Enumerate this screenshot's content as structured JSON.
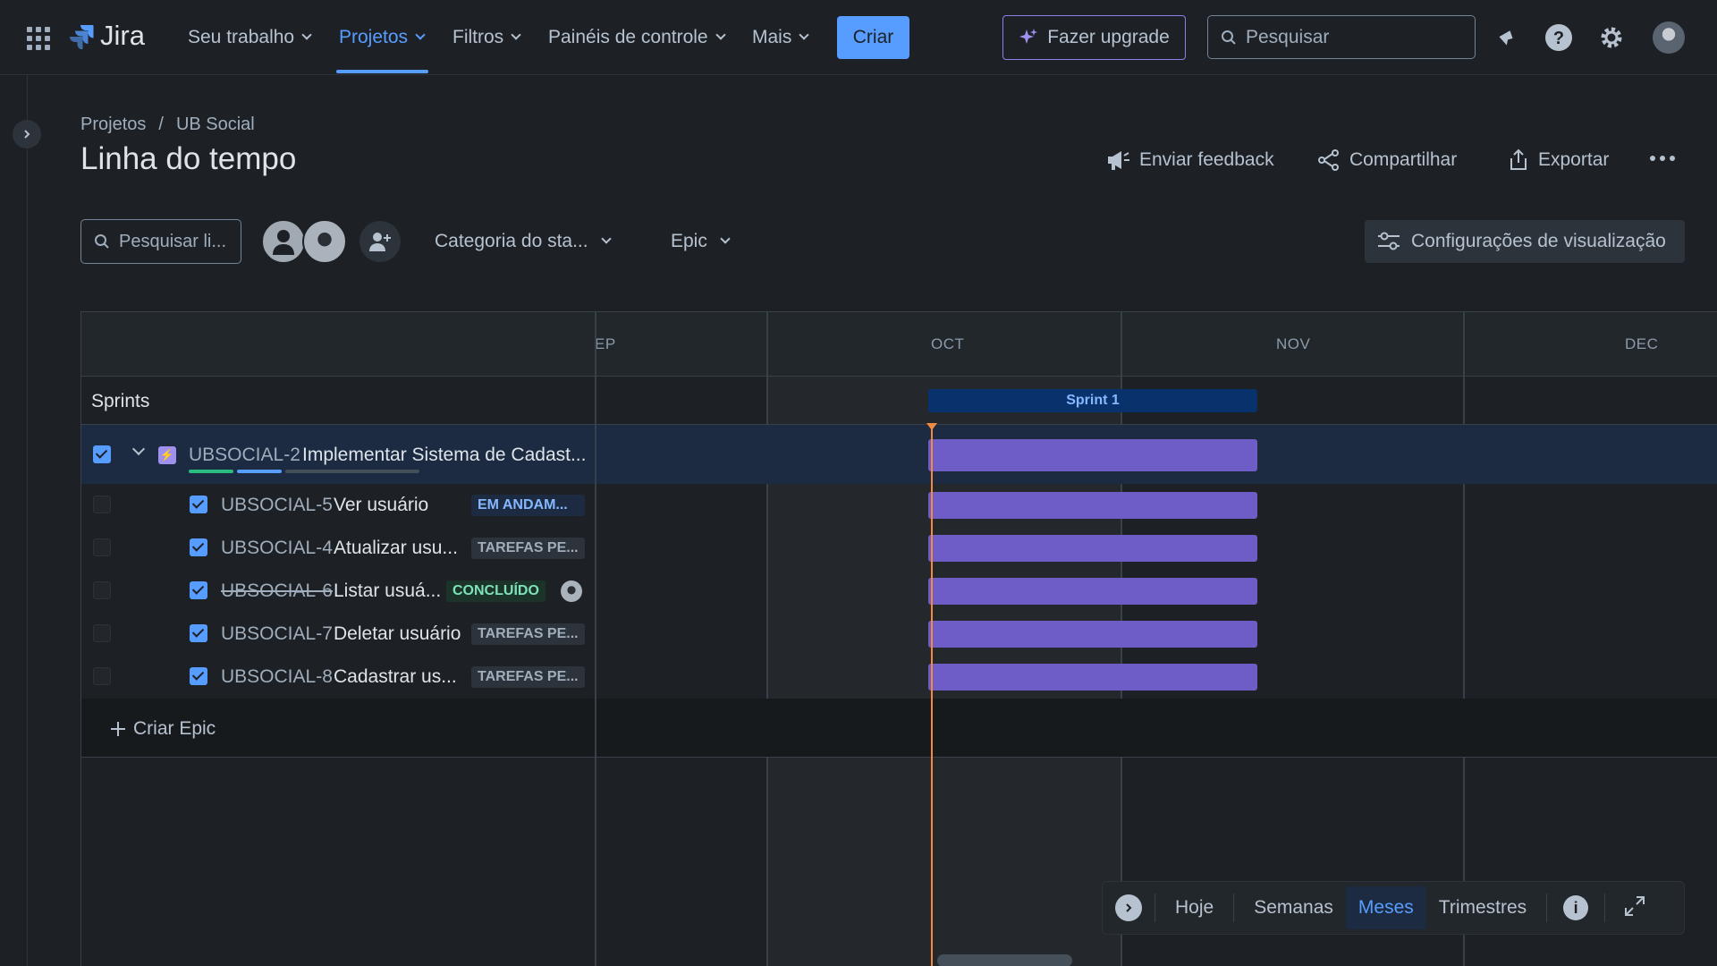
{
  "nav": {
    "product": "Jira",
    "items": [
      {
        "label": "Seu trabalho"
      },
      {
        "label": "Projetos"
      },
      {
        "label": "Filtros"
      },
      {
        "label": "Painéis de controle"
      },
      {
        "label": "Mais"
      }
    ],
    "create_label": "Criar",
    "upgrade_label": "Fazer upgrade",
    "search_placeholder": "Pesquisar"
  },
  "breadcrumb": {
    "root": "Projetos",
    "separator": "/",
    "project": "UB Social"
  },
  "page_title": "Linha do tempo",
  "actions": {
    "feedback": "Enviar feedback",
    "share": "Compartilhar",
    "export": "Exportar"
  },
  "filters": {
    "search_placeholder": "Pesquisar li...",
    "status_category": "Categoria do sta...",
    "epic": "Epic",
    "view_settings": "Configurações de visualização"
  },
  "timeline": {
    "months": [
      "EP",
      "OCT",
      "NOV",
      "DEC"
    ],
    "sprints_label": "Sprints",
    "sprint_name": "Sprint 1",
    "epic": {
      "key": "UBSOCIAL-2",
      "summary": "Implementar Sistema de Cadast..."
    },
    "issues": [
      {
        "key": "UBSOCIAL-5",
        "summary": "Ver usuário",
        "status": "EM ANDAM...",
        "status_type": "progress"
      },
      {
        "key": "UBSOCIAL-4",
        "summary": "Atualizar usu...",
        "status": "TAREFAS PE...",
        "status_type": "todo"
      },
      {
        "key": "UBSOCIAL-6",
        "summary": "Listar usuá...",
        "status": "CONCLUÍDO",
        "status_type": "done"
      },
      {
        "key": "UBSOCIAL-7",
        "summary": "Deletar usuário",
        "status": "TAREFAS PE...",
        "status_type": "todo"
      },
      {
        "key": "UBSOCIAL-8",
        "summary": "Cadastrar us...",
        "status": "TAREFAS PE...",
        "status_type": "todo"
      }
    ],
    "create_epic": "Criar Epic"
  },
  "zoom": {
    "today": "Hoje",
    "weeks": "Semanas",
    "months": "Meses",
    "quarters": "Trimestres"
  },
  "colors": {
    "accent": "#579dff",
    "bar": "#6e5dc6",
    "today": "#f38a3f",
    "epic": "#9f8fef"
  }
}
